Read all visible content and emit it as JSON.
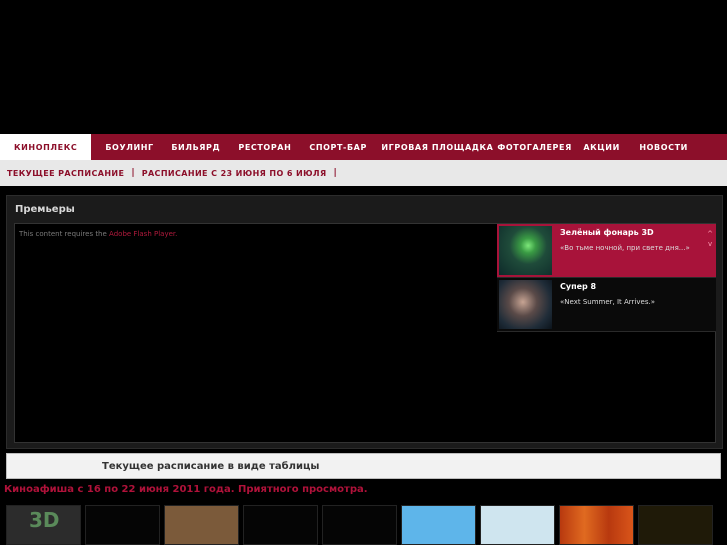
{
  "nav": {
    "items": [
      {
        "label": "КИНОПЛЕКС",
        "active": true
      },
      {
        "label": "БОУЛИНГ"
      },
      {
        "label": "БИЛЬЯРД"
      },
      {
        "label": "РЕСТОРАН"
      },
      {
        "label": "СПОРТ-БАР"
      },
      {
        "label": "ИГРОВАЯ ПЛОЩАДКА"
      },
      {
        "label": "ФОТОГАЛЕРЕЯ"
      },
      {
        "label": "АКЦИИ"
      },
      {
        "label": "НОВОСТИ"
      }
    ]
  },
  "subnav": {
    "current": "ТЕКУЩЕЕ РАСПИСАНИЕ",
    "upcoming": "РАСПИСАНИЕ С 23 ИЮНЯ ПО 6 ИЮЛЯ"
  },
  "premieres": {
    "title": "Премьеры",
    "flash_text": "This content requires the",
    "flash_link": "Adobe Flash Player.",
    "items": [
      {
        "title": "Зелёный фонарь 3D",
        "tagline": "«Во тьме ночной, при свете дня...»",
        "thumb_icon": "green-lantern-poster"
      },
      {
        "title": "Супер 8",
        "tagline": "«Next Summer, It Arrives.»",
        "thumb_icon": "super-8-poster"
      }
    ],
    "arrow_up": "^",
    "arrow_down": "v"
  },
  "table_link": "Текущее расписание в виде таблицы",
  "afisha": "Киноафиша с 16 по 22 июня 2011 года. Приятного просмотра.",
  "posters": [
    {
      "name": "3d-logo-poster",
      "color": "#2c2c2c"
    },
    {
      "name": "black-poster",
      "color": "#050505"
    },
    {
      "name": "brown-poster",
      "color": "#7b5a3a"
    },
    {
      "name": "black-poster",
      "color": "#050505"
    },
    {
      "name": "black-poster",
      "color": "#050505"
    },
    {
      "name": "blue-poster",
      "color": "#5eb5ea"
    },
    {
      "name": "light-blue-poster",
      "color": "#cfe5ef"
    },
    {
      "name": "orange-poster",
      "color": "#c44a15"
    },
    {
      "name": "dark-poster",
      "color": "#1f1a08"
    }
  ],
  "colors": {
    "brand": "#8c0f2a",
    "selected": "#a8133a"
  }
}
